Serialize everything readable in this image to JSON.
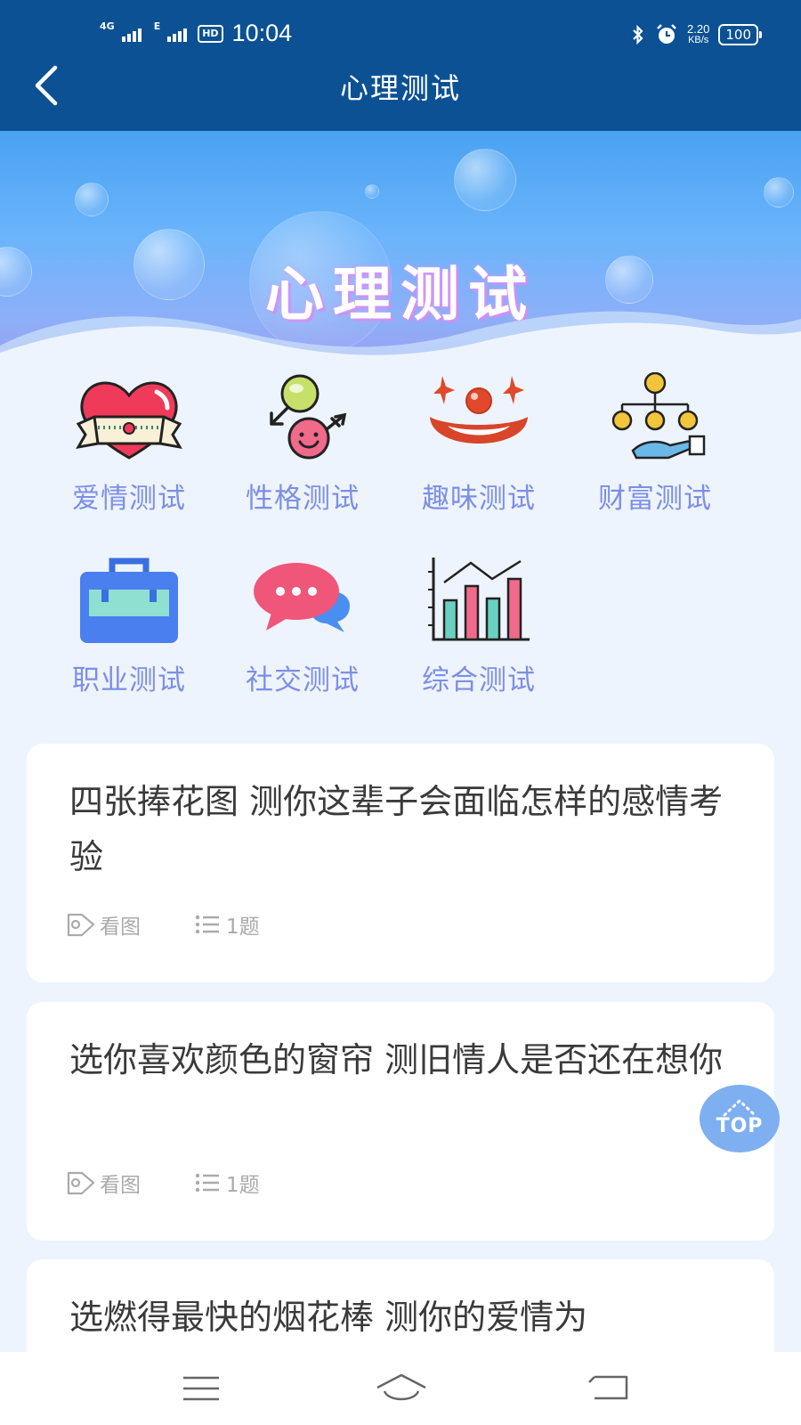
{
  "status_bar": {
    "net_primary": "4G",
    "net_secondary": "E",
    "hd_badge": "HD",
    "time": "10:04",
    "speed_value": "2.20",
    "speed_unit": "KB/s",
    "battery": "100"
  },
  "header": {
    "title": "心理测试"
  },
  "banner": {
    "title": "心理测试"
  },
  "categories": [
    {
      "label": "爱情测试",
      "icon": "heart-icon"
    },
    {
      "label": "性格测试",
      "icon": "gender-icon"
    },
    {
      "label": "趣味测试",
      "icon": "clown-icon"
    },
    {
      "label": "财富测试",
      "icon": "coins-icon"
    },
    {
      "label": "职业测试",
      "icon": "toolbox-icon"
    },
    {
      "label": "社交测试",
      "icon": "chat-bubble-icon"
    },
    {
      "label": "综合测试",
      "icon": "bar-chart-icon"
    }
  ],
  "tests": [
    {
      "title": "四张捧花图 测你这辈子会面临怎样的感情考验",
      "tag": "看图",
      "count": "1题"
    },
    {
      "title": "选你喜欢颜色的窗帘 测旧情人是否还在想你",
      "tag": "看图",
      "count": "1题"
    },
    {
      "title": "选燃得最快的烟花棒 测你的爱情为",
      "tag": "",
      "count": ""
    }
  ],
  "scroll_top": {
    "label": "TOP"
  },
  "colors": {
    "header_bg": "#0b5194",
    "category_label": "#7d8ee6",
    "page_bg": "#edf4fd",
    "top_button": "#7eaff0"
  }
}
